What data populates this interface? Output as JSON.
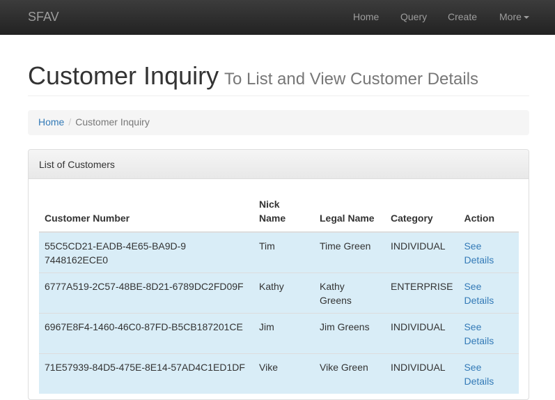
{
  "navbar": {
    "brand": "SFAV",
    "links": [
      "Home",
      "Query",
      "Create",
      "More"
    ]
  },
  "header": {
    "title": "Customer Inquiry",
    "subtitle": "To List and View Customer Details"
  },
  "breadcrumb": {
    "home": "Home",
    "current": "Customer Inquiry"
  },
  "panel": {
    "title": "List of Customers"
  },
  "table": {
    "headers": [
      "Customer Number",
      "Nick Name",
      "Legal Name",
      "Category",
      "Action"
    ],
    "rows": [
      {
        "number": "55C5CD21-EADB-4E65-BA9D-97448162ECE0",
        "nick": "Tim",
        "legal": "Time Green",
        "category": "INDIVIDUAL",
        "action": "See Details"
      },
      {
        "number": "6777A519-2C57-48BE-8D21-6789DC2FD09F",
        "nick": "Kathy",
        "legal": "Kathy Greens",
        "category": "ENTERPRISE",
        "action": "See Details"
      },
      {
        "number": "6967E8F4-1460-46C0-87FD-B5CB187201CE",
        "nick": "Jim",
        "legal": "Jim Greens",
        "category": "INDIVIDUAL",
        "action": "See Details"
      },
      {
        "number": "71E57939-84D5-475E-8E14-57AD4C1ED1DF",
        "nick": "Vike",
        "legal": "Vike Green",
        "category": "INDIVIDUAL",
        "action": "See Details"
      }
    ]
  },
  "colors": {
    "navbar": "#222222",
    "link": "#337ab7",
    "row_highlight": "#d9edf7"
  }
}
